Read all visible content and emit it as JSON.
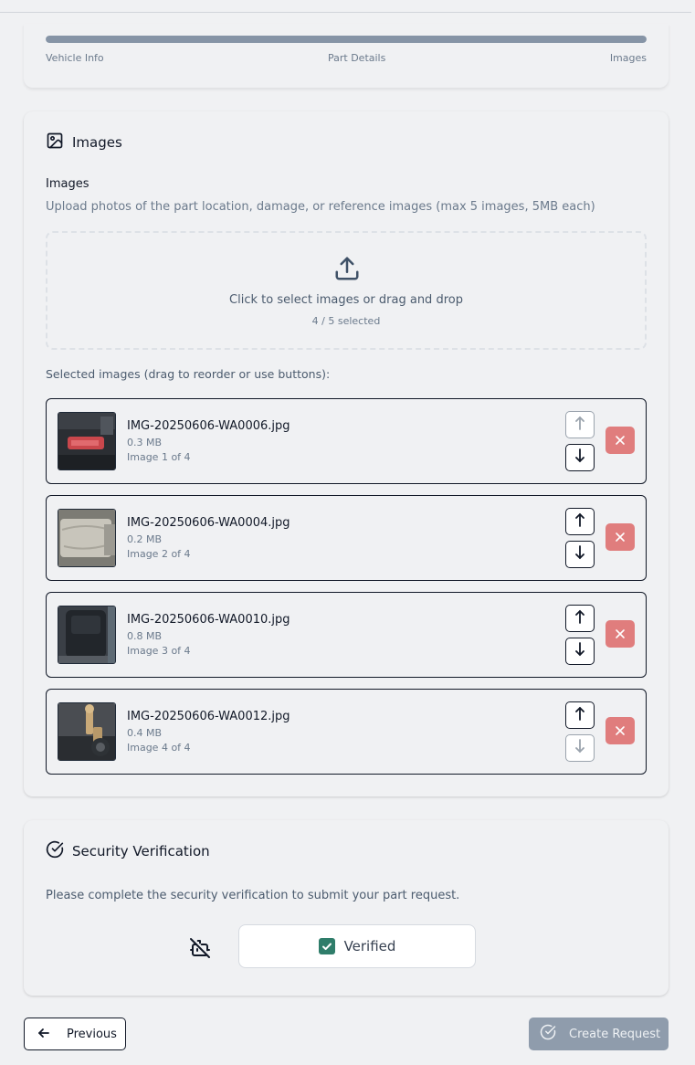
{
  "progress": {
    "value_percent": 100,
    "steps": [
      "Vehicle Info",
      "Part Details",
      "Images"
    ]
  },
  "images_section": {
    "title": "Images",
    "field_label": "Images",
    "field_description": "Upload photos of the part location, damage, or reference images (max 5 images, 5MB each)",
    "dropzone_text": "Click to select images or drag and drop",
    "dropzone_count": "4 / 5 selected",
    "selected_label": "Selected images (drag to reorder or use buttons):",
    "items": [
      {
        "name": "IMG-20250606-WA0006.jpg",
        "size": "0.3 MB",
        "index_label": "Image 1 of 4",
        "thumb": "red-buckle"
      },
      {
        "name": "IMG-20250606-WA0004.jpg",
        "size": "0.2 MB",
        "index_label": "Image 2 of 4",
        "thumb": "grey-fabric"
      },
      {
        "name": "IMG-20250606-WA0010.jpg",
        "size": "0.8 MB",
        "index_label": "Image 3 of 4",
        "thumb": "dark-buckle"
      },
      {
        "name": "IMG-20250606-WA0012.jpg",
        "size": "0.4 MB",
        "index_label": "Image 4 of 4",
        "thumb": "latch-pin"
      }
    ]
  },
  "security_section": {
    "title": "Security Verification",
    "description": "Please complete the security verification to submit your part request.",
    "captcha_label": "Verified",
    "captcha_checked": true
  },
  "footer": {
    "previous_label": "Previous",
    "create_label": "Create Request"
  },
  "colors": {
    "progress_fill": "#8694a6",
    "remove_button": "#e07d7d",
    "checkbox": "#2f7d6a",
    "create_button": "#8f9cac"
  }
}
